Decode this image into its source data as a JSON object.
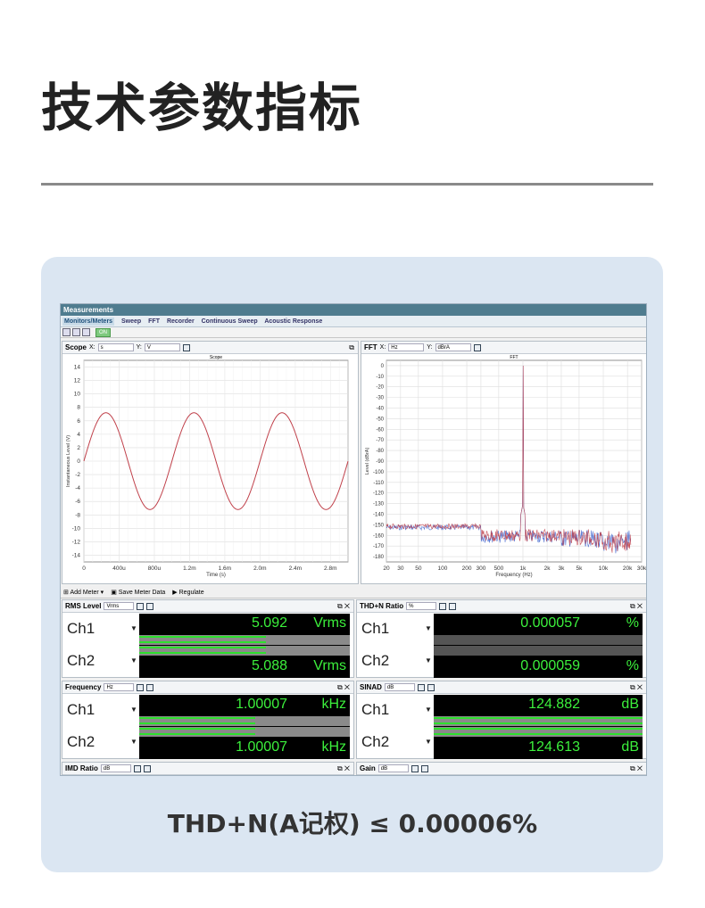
{
  "page": {
    "title": "技术参数指标",
    "caption": "THD+N(A记权) ≤ 0.00006%"
  },
  "app": {
    "window_title": "Measurements",
    "tabs": [
      "Monitors/Meters",
      "Sweep",
      "FFT",
      "Recorder",
      "Continuous Sweep",
      "Acoustic Response"
    ],
    "on_label": "ON"
  },
  "scope": {
    "header": "Scope",
    "x_label": "X:",
    "x_unit": "s",
    "y_label": "Y:",
    "y_unit": "V",
    "plot_title": "Scope",
    "xlabel": "Time (s)",
    "ylabel": "Instantaneous Level (V)",
    "y_ticks": [
      "14",
      "12",
      "10",
      "8",
      "6",
      "4",
      "2",
      "0",
      "-2",
      "-4",
      "-6",
      "-8",
      "-10",
      "-12",
      "-14"
    ],
    "x_ticks": [
      "0",
      "400u",
      "800u",
      "1.2m",
      "1.6m",
      "2.0m",
      "2.4m",
      "2.8m"
    ]
  },
  "fft": {
    "header": "FFT",
    "x_label": "X:",
    "x_unit": "Hz",
    "y_label": "Y:",
    "y_unit": "dBrA",
    "plot_title": "FFT",
    "xlabel": "Frequency (Hz)",
    "ylabel": "Level (dBrA)",
    "y_ticks": [
      "0",
      "-10",
      "-20",
      "-30",
      "-40",
      "-50",
      "-60",
      "-70",
      "-80",
      "-90",
      "-100",
      "-110",
      "-120",
      "-130",
      "-140",
      "-150",
      "-160",
      "-170",
      "-180"
    ],
    "x_ticks": [
      "20",
      "30",
      "50",
      "100",
      "200",
      "300",
      "500",
      "1k",
      "2k",
      "3k",
      "5k",
      "10k",
      "20k",
      "30k"
    ]
  },
  "chart_data": [
    {
      "type": "line",
      "title": "Scope",
      "xlabel": "Time (s)",
      "ylabel": "Instantaneous Level (V)",
      "xlim": [
        0,
        0.003
      ],
      "ylim": [
        -15,
        15
      ],
      "series": [
        {
          "name": "Ch1",
          "amplitude": 7.2,
          "frequency_hz": 1000,
          "color": "#c0404a"
        }
      ]
    },
    {
      "type": "line",
      "title": "FFT",
      "xlabel": "Frequency (Hz)",
      "ylabel": "Level (dBrA)",
      "xscale": "log",
      "xlim": [
        20,
        30000
      ],
      "ylim": [
        -185,
        5
      ],
      "peak": {
        "x": 1000,
        "y": 0
      },
      "noise_floor_range": [
        -170,
        -145
      ],
      "series": [
        {
          "name": "Ch1",
          "color": "#3a5fcd"
        },
        {
          "name": "Ch2",
          "color": "#c0404a"
        }
      ]
    }
  ],
  "toolbar": {
    "add_meter": "Add Meter",
    "save_meter_data": "Save Meter Data",
    "regulate": "Regulate"
  },
  "meters": [
    {
      "title": "RMS Level",
      "unit_select": "Vrms",
      "rows": [
        {
          "ch": "Ch1",
          "value": "5.092",
          "unit": "Vrms",
          "bar": 0.6
        },
        {
          "ch": "Ch2",
          "value": "5.088",
          "unit": "Vrms",
          "bar": 0.6
        }
      ]
    },
    {
      "title": "THD+N Ratio",
      "unit_select": "%",
      "rows": [
        {
          "ch": "Ch1",
          "value": "0.000057",
          "unit": "%",
          "bar": 0.0
        },
        {
          "ch": "Ch2",
          "value": "0.000059",
          "unit": "%",
          "bar": 0.0
        }
      ]
    },
    {
      "title": "Frequency",
      "unit_select": "Hz",
      "rows": [
        {
          "ch": "Ch1",
          "value": "1.00007",
          "unit": "kHz",
          "bar": 0.55
        },
        {
          "ch": "Ch2",
          "value": "1.00007",
          "unit": "kHz",
          "bar": 0.55
        }
      ]
    },
    {
      "title": "SINAD",
      "unit_select": "dB",
      "rows": [
        {
          "ch": "Ch1",
          "value": "124.882",
          "unit": "dB",
          "bar": 1.0
        },
        {
          "ch": "Ch2",
          "value": "124.613",
          "unit": "dB",
          "bar": 1.0
        }
      ]
    },
    {
      "title": "IMD Ratio",
      "unit_select": "dB",
      "rows": []
    },
    {
      "title": "Gain",
      "unit_select": "dB",
      "rows": []
    }
  ]
}
